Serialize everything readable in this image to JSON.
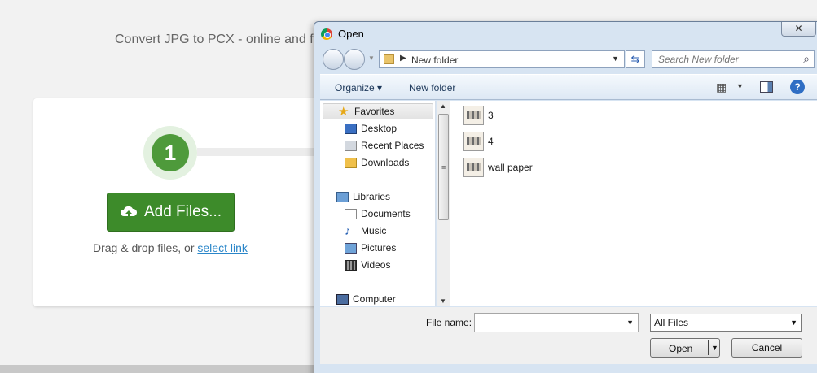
{
  "background": {
    "subtitle": "Convert JPG to PCX - online and fr",
    "step_number": "1",
    "add_files_label": "Add Files...",
    "drag_text": "Drag & drop files, or ",
    "select_link": "select link"
  },
  "dialog": {
    "title": "Open",
    "close_glyph": "✕",
    "address": {
      "path": "New folder"
    },
    "search_placeholder": "Search New folder",
    "toolbar": {
      "organize": "Organize ▾",
      "new_folder": "New folder",
      "help": "?"
    },
    "nav": {
      "favorites": "Favorites",
      "desktop": "Desktop",
      "recent_places": "Recent Places",
      "downloads": "Downloads",
      "libraries": "Libraries",
      "documents": "Documents",
      "music": "Music",
      "pictures": "Pictures",
      "videos": "Videos",
      "computer": "Computer"
    },
    "files": [
      "3",
      "4",
      "wall paper"
    ],
    "file_name_label": "File name:",
    "file_name_value": "",
    "file_type": "All Files",
    "open_button": "Open",
    "cancel_button": "Cancel"
  }
}
